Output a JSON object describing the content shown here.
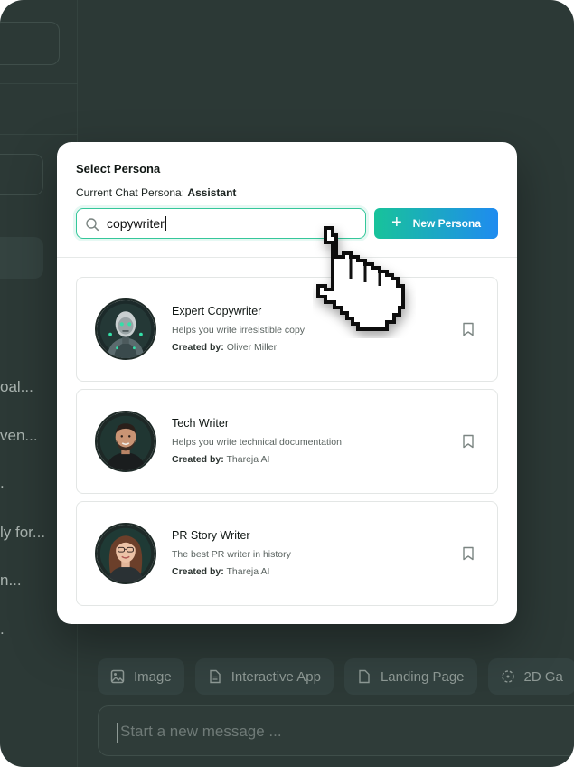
{
  "background": {
    "sidebar_snippets": [
      "oal...",
      "ven...",
      ".",
      "ly for...",
      "n...",
      "."
    ],
    "chips": [
      {
        "label": "Image",
        "icon": "image-icon"
      },
      {
        "label": "Interactive App",
        "icon": "document-icon"
      },
      {
        "label": "Landing Page",
        "icon": "document-icon"
      },
      {
        "label": "2D Ga",
        "icon": "game-icon"
      }
    ],
    "composer_placeholder": "Start a new message ..."
  },
  "modal": {
    "title": "Select Persona",
    "current_label": "Current Chat Persona:",
    "current_value": "Assistant",
    "search_value": "copywriter",
    "new_button_label": "New Persona",
    "personas": [
      {
        "name": "Expert Copywriter",
        "description": "Helps you write irresistible copy",
        "created_by_label": "Created by:",
        "created_by": "Oliver Miller",
        "avatar": "robot-avatar"
      },
      {
        "name": "Tech Writer",
        "description": "Helps you write technical documentation",
        "created_by_label": "Created by:",
        "created_by": "Thareja AI",
        "avatar": "man-avatar"
      },
      {
        "name": "PR Story Writer",
        "description": "The best PR writer in history",
        "created_by_label": "Created by:",
        "created_by": "Thareja AI",
        "avatar": "woman-avatar"
      }
    ]
  },
  "colors": {
    "accent_green": "#18c39a",
    "accent_blue": "#1f8bf0",
    "background_dark": "#2c3936"
  }
}
